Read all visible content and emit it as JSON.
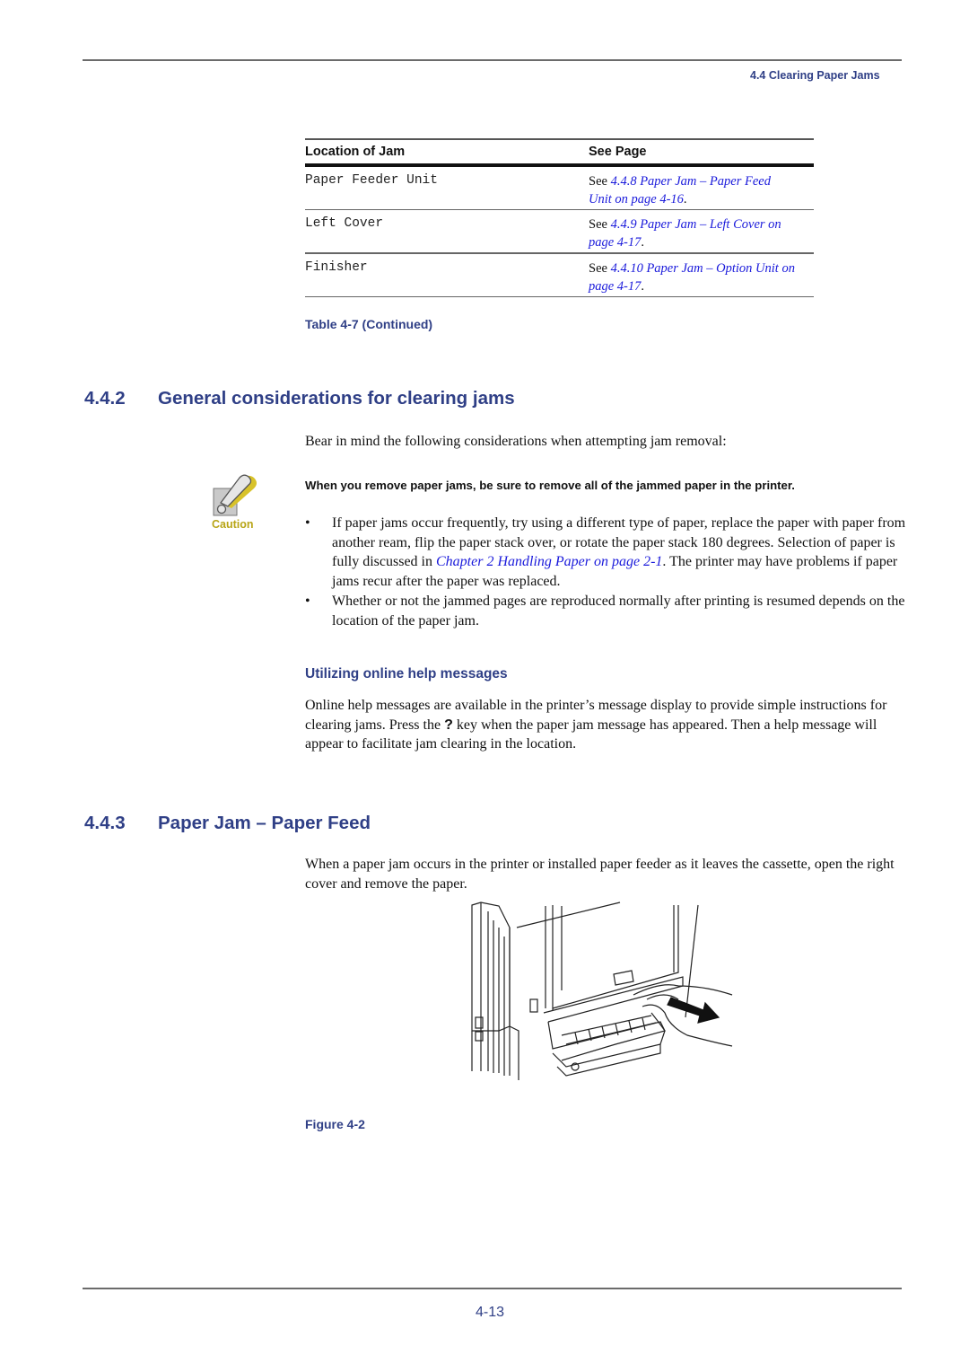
{
  "header": {
    "running_head": "4.4 Clearing Paper Jams"
  },
  "table": {
    "columns": [
      "Location of Jam",
      "See Page"
    ],
    "rows": [
      {
        "location": "Paper Feeder Unit",
        "see": "See ",
        "link_line1": "4.4.8 Paper Jam – Paper Feed",
        "link_line2": "Unit on page 4-16",
        "end": "."
      },
      {
        "location": "Left Cover",
        "see": "See ",
        "link_line1": "4.4.9 Paper Jam – Left Cover on",
        "link_line2": "page 4-17",
        "end": "."
      },
      {
        "location": "Finisher",
        "see": "See ",
        "link_line1": "4.4.10 Paper Jam – Option Unit on",
        "link_line2": "page 4-17",
        "end": "."
      }
    ],
    "caption": "Table 4-7  (Continued)"
  },
  "section_442": {
    "number": "4.4.2",
    "title": "General considerations for clearing jams",
    "intro": "Bear in mind the following considerations when attempting jam removal:",
    "caution_label": "Caution",
    "caution_text": "When you remove paper jams, be sure to remove all of the jammed paper in the printer.",
    "bullets": [
      {
        "before": "If paper jams occur frequently, try using a different type of paper, replace the paper with paper from another ream, flip the paper stack over, or rotate the paper stack 180 degrees. Selection of paper is fully discussed in ",
        "link": "Chapter 2 Handling Paper on page 2-1",
        "after": ". The printer may have problems if paper jams recur after the paper was replaced."
      },
      {
        "before": "Whether or not the jammed pages are reproduced normally after printing is resumed depends on the location of the paper jam.",
        "link": "",
        "after": ""
      }
    ],
    "subheading": "Utilizing online help messages",
    "online_before": "Online help messages are available in the printer’s message display to provide simple instructions for clearing jams. Press the ",
    "online_key": "?",
    "online_after": " key when the paper jam message has appeared. Then a help message will appear to facilitate jam clearing in the location."
  },
  "section_443": {
    "number": "4.4.3",
    "title": "Paper Jam – Paper Feed",
    "intro": "When a paper jam occurs in the printer or installed paper feeder as it leaves the cassette, open the right cover and remove the paper.",
    "figure_caption": "Figure 4-2"
  },
  "footer": {
    "page_number": "4-13"
  },
  "colors": {
    "heading_blue": "#2f3f86",
    "link_blue": "#1a1adb",
    "caution_yellow": "#b8a517"
  }
}
